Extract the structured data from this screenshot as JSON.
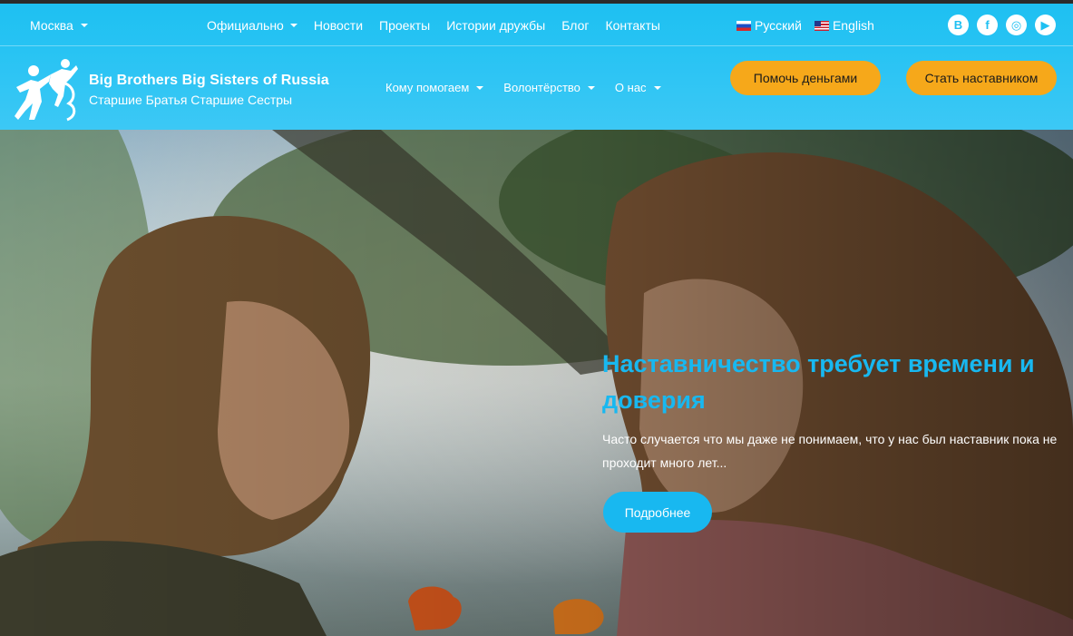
{
  "topbar": {
    "city": "Москва",
    "nav": [
      "Официально",
      "Новости",
      "Проекты",
      "Истории дружбы",
      "Блог",
      "Контакты"
    ],
    "languages": [
      "Русский",
      "English"
    ],
    "socials": [
      "В",
      "f",
      "◎",
      "▶"
    ]
  },
  "logo": {
    "title": "Big Brothers Big Sisters of Russia",
    "subtitle": "Старшие Братья Старшие Сестры"
  },
  "mainnav": [
    "Кому помогаем",
    "Волонтёрство",
    "О нас"
  ],
  "buttons": {
    "donate": "Помочь деньгами",
    "mentor": "Стать наставником"
  },
  "hero": {
    "title": "Наставничество требует времени и доверия",
    "text": "Часто случается что мы даже не понимаем, что у нас был наставник пока не проходит много лет...",
    "button": "Подробнее"
  },
  "colors": {
    "header": "#27c3f3",
    "accent": "#f6a81a",
    "heroTitle": "#18b8f0"
  }
}
